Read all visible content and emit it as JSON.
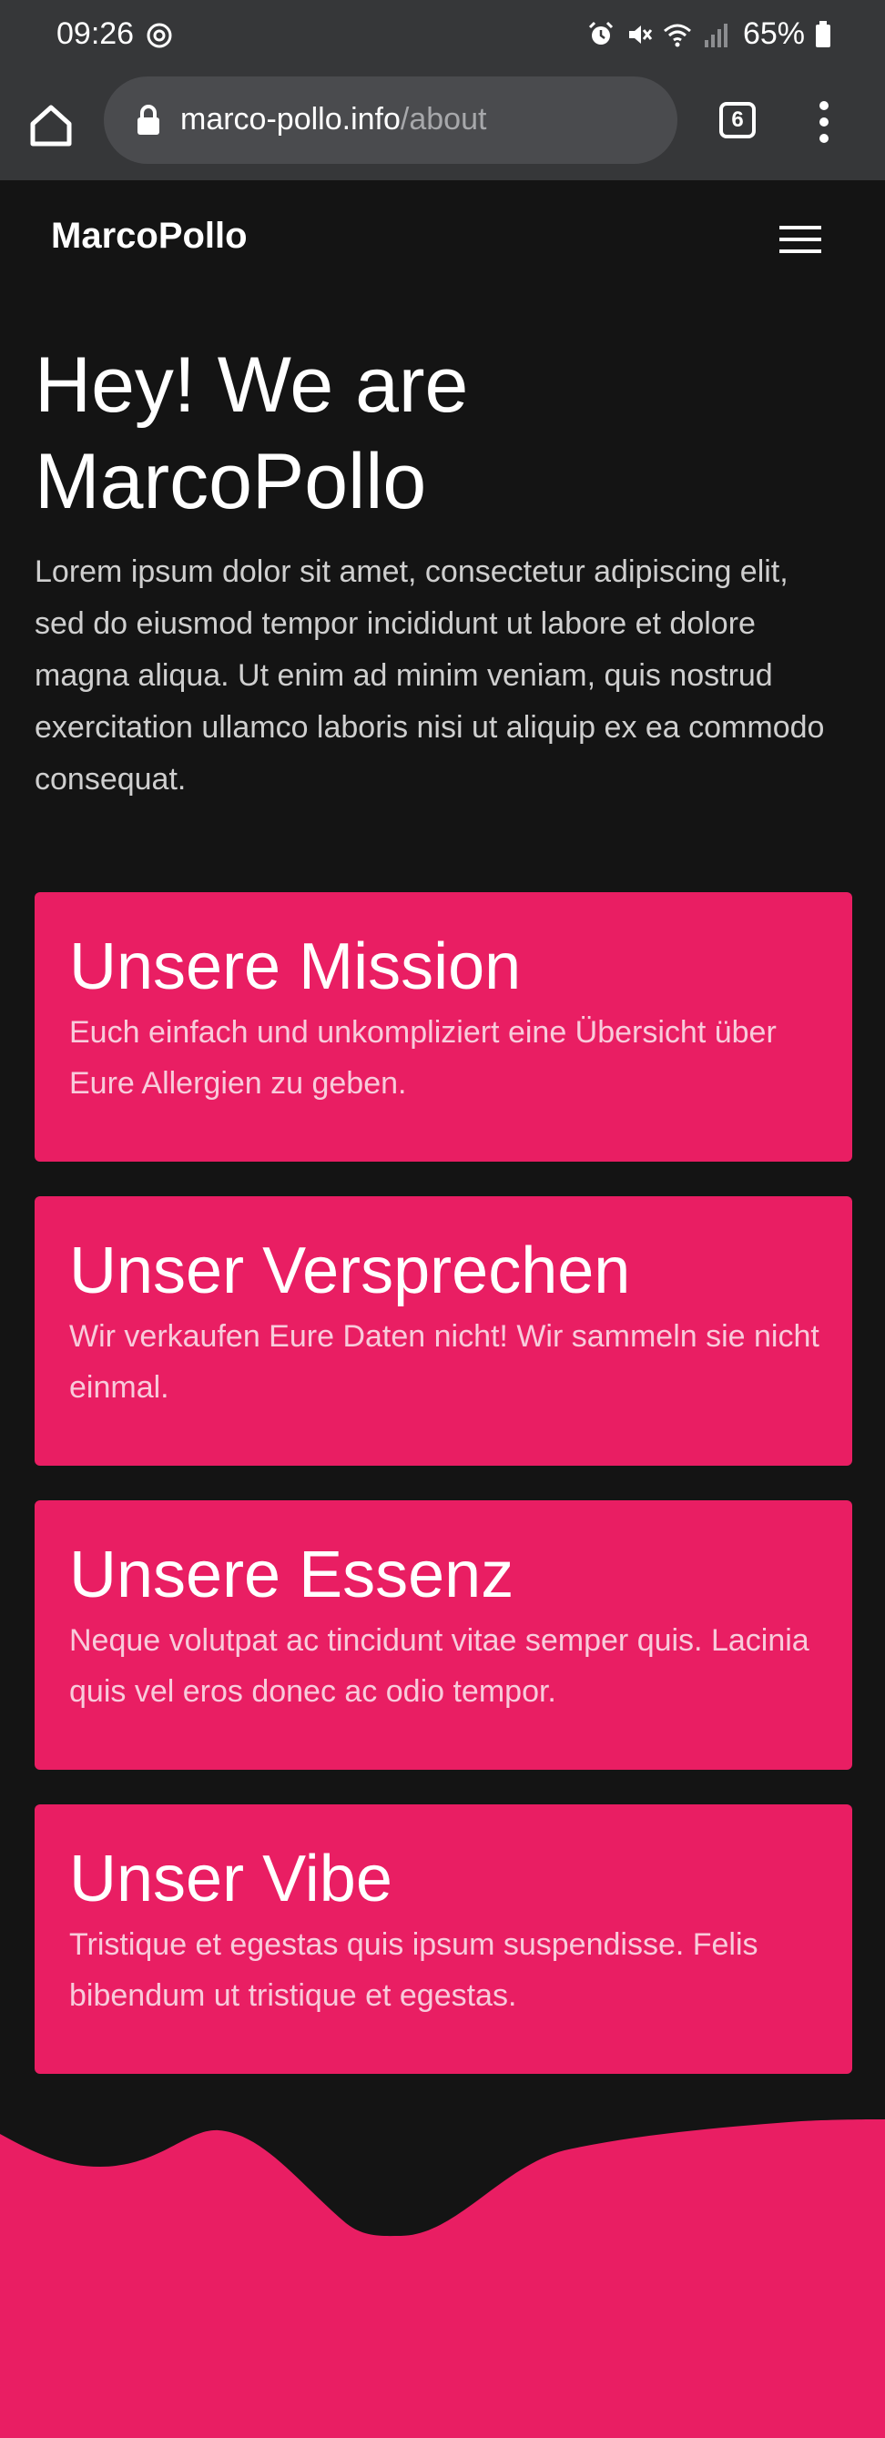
{
  "status_bar": {
    "time": "09:26",
    "battery": "65%",
    "icons": [
      "chrome-notification-icon",
      "alarm-icon",
      "mute-icon",
      "wifi-icon",
      "signal-icon",
      "battery-icon"
    ]
  },
  "browser": {
    "url_host": "marco-pollo.info",
    "url_path": "/about",
    "tab_count": "6",
    "icons": [
      "home-icon",
      "lock-icon",
      "more-vert-icon"
    ]
  },
  "site": {
    "brand": "MarcoPollo",
    "hero_title_line1": "Hey! We are",
    "hero_title_line2": "MarcoPollo",
    "hero_text": "Lorem ipsum dolor sit amet, consectetur adipiscing elit, sed do eiusmod tempor incididunt ut labore et dolore magna aliqua. Ut enim ad minim veniam, quis nostrud exercitation ullamco laboris nisi ut aliquip ex ea commodo consequat."
  },
  "cards": [
    {
      "title": "Unsere Mission",
      "text": "Euch einfach und unkompliziert eine Übersicht über Eure Allergien zu geben."
    },
    {
      "title": "Unser Versprechen",
      "text": "Wir verkaufen Eure Daten nicht! Wir sammeln sie nicht einmal."
    },
    {
      "title": "Unsere Essenz",
      "text": "Neque volutpat ac tincidunt vitae semper quis. Lacinia quis vel eros donec ac odio tempor."
    },
    {
      "title": "Unser Vibe",
      "text": "Tristique et egestas quis ipsum suspendisse. Felis bibendum ut tristique et egestas."
    }
  ],
  "colors": {
    "accent": "#e91e63",
    "background": "#141414",
    "browser_chrome": "#363739"
  }
}
